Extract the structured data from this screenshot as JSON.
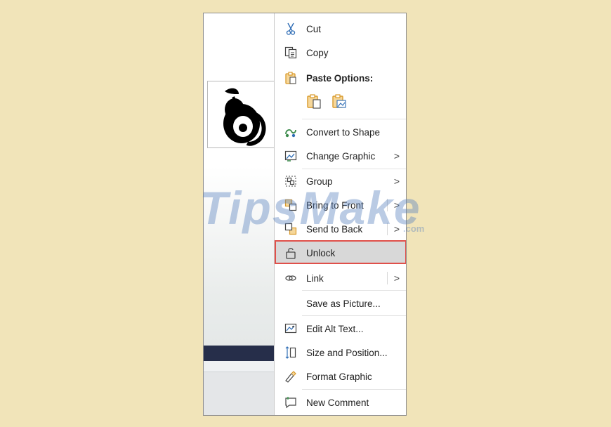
{
  "menu": {
    "cut": "Cut",
    "copy": "Copy",
    "paste_options": "Paste Options:",
    "convert_to_shape": "Convert to Shape",
    "change_graphic": "Change Graphic",
    "group": "Group",
    "bring_to_front": "Bring to Front",
    "send_to_back": "Send to Back",
    "unlock": "Unlock",
    "link": "Link",
    "save_as_picture": "Save as Picture...",
    "edit_alt_text": "Edit Alt Text...",
    "size_and_position": "Size and Position...",
    "format_graphic": "Format Graphic",
    "new_comment": "New Comment",
    "submenu_arrow": ">"
  },
  "watermark": {
    "text": "TipsMake",
    "suffix": ".com"
  },
  "colors": {
    "background": "#f1e4b9",
    "highlight_border": "#e0504a",
    "highlight_fill": "#d8d8d8",
    "icon_orange": "#d99a2b",
    "icon_blue": "#2f6db5",
    "icon_green": "#3a8a4a",
    "navy": "#262e4a"
  }
}
